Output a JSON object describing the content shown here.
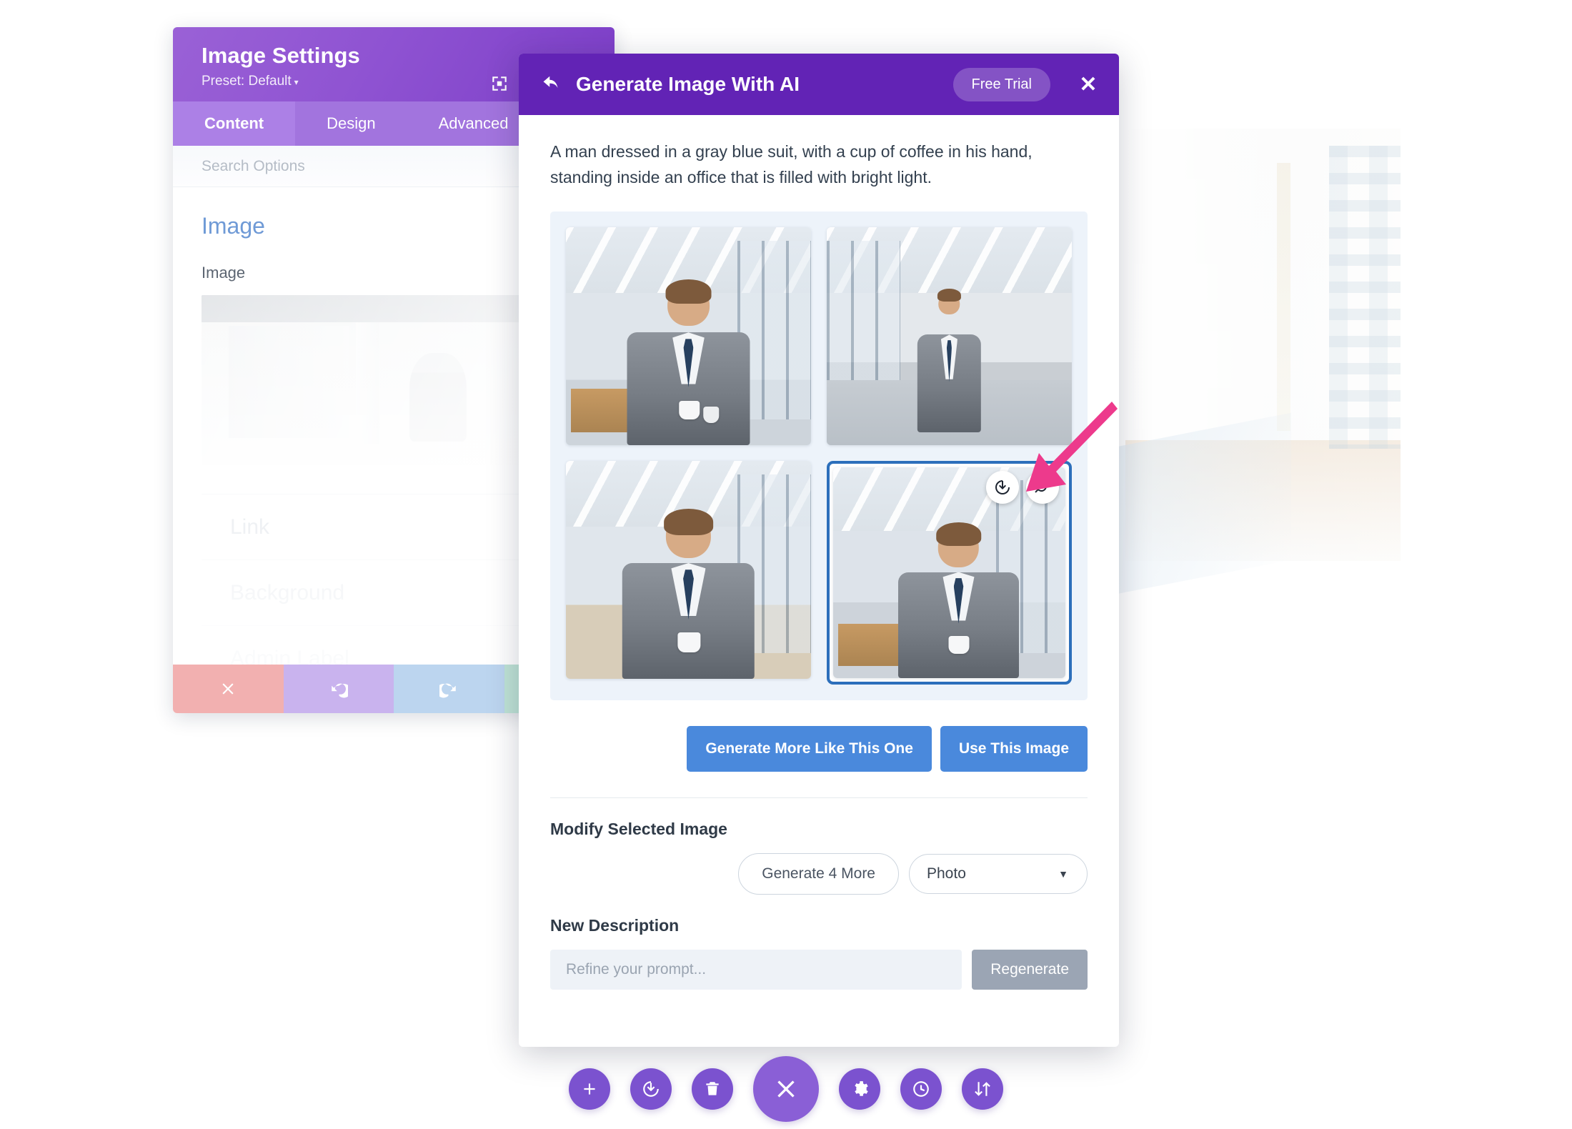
{
  "settings_panel": {
    "title": "Image Settings",
    "preset": "Preset: Default",
    "preset_caret": "▾",
    "expand_icon": "fullscreen-icon",
    "tabs": [
      {
        "label": "Content",
        "active": true
      },
      {
        "label": "Design",
        "active": false
      },
      {
        "label": "Advanced",
        "active": false
      }
    ],
    "search_placeholder": "Search Options",
    "section_title": "Image",
    "field_label": "Image",
    "rows": [
      "Link",
      "Background",
      "Admin Label"
    ],
    "footer_buttons": [
      {
        "name": "cancel-button",
        "icon": "close-icon"
      },
      {
        "name": "undo-button",
        "icon": "undo-icon"
      },
      {
        "name": "redo-button",
        "icon": "redo-icon"
      },
      {
        "name": "save-button",
        "icon": "check-icon"
      }
    ]
  },
  "modal": {
    "back_icon": "back-arrow-icon",
    "title": "Generate Image With AI",
    "trial_badge": "Free Trial",
    "close_label": "✕",
    "prompt": "A man dressed in a gray blue suit, with a cup of coffee in his hand, standing inside an office that is filled with bright light.",
    "gallery": {
      "images": [
        {
          "alt": "Man in gray suit holding two coffee cups in open-plan office",
          "selected": false
        },
        {
          "alt": "Man in gray suit walking down bright office corridor",
          "selected": false
        },
        {
          "alt": "Man in gray suit holding a coffee cup in bright office",
          "selected": false
        },
        {
          "alt": "Man in gray suit with coffee cup beside office window",
          "selected": true
        }
      ],
      "overlay_buttons": [
        {
          "name": "download-image-button",
          "icon": "download-icon"
        },
        {
          "name": "zoom-image-button",
          "icon": "magnifier-icon"
        }
      ]
    },
    "actions": {
      "generate_more_like": "Generate More Like This One",
      "use_this_image": "Use This Image"
    },
    "modify_section": {
      "label": "Modify Selected Image",
      "generate_more": "Generate 4 More",
      "style_value": "Photo",
      "style_caret": "▼"
    },
    "new_description": {
      "label": "New Description",
      "input_value": "",
      "placeholder": "Refine your prompt...",
      "regenerate": "Regenerate"
    }
  },
  "annotation": {
    "arrow_color": "#ED3A8C",
    "points_to": "download-image-button"
  },
  "toolbar": {
    "buttons": [
      {
        "name": "add-module-button",
        "icon": "plus-icon"
      },
      {
        "name": "save-button",
        "icon": "save-icon"
      },
      {
        "name": "delete-button",
        "icon": "trash-icon"
      },
      {
        "name": "close-builder-button",
        "icon": "close-icon"
      },
      {
        "name": "settings-button",
        "icon": "gear-icon"
      },
      {
        "name": "history-button",
        "icon": "clock-icon"
      },
      {
        "name": "responsive-button",
        "icon": "sort-icon"
      }
    ]
  },
  "colors": {
    "modal_header": "#6223b5",
    "panel_header": "#8f53d2",
    "accent_blue": "#4a89dc",
    "selection_blue": "#2c6fbb",
    "toolbar_purple": "#7b52cf",
    "arrow_pink": "#ED3A8C"
  }
}
